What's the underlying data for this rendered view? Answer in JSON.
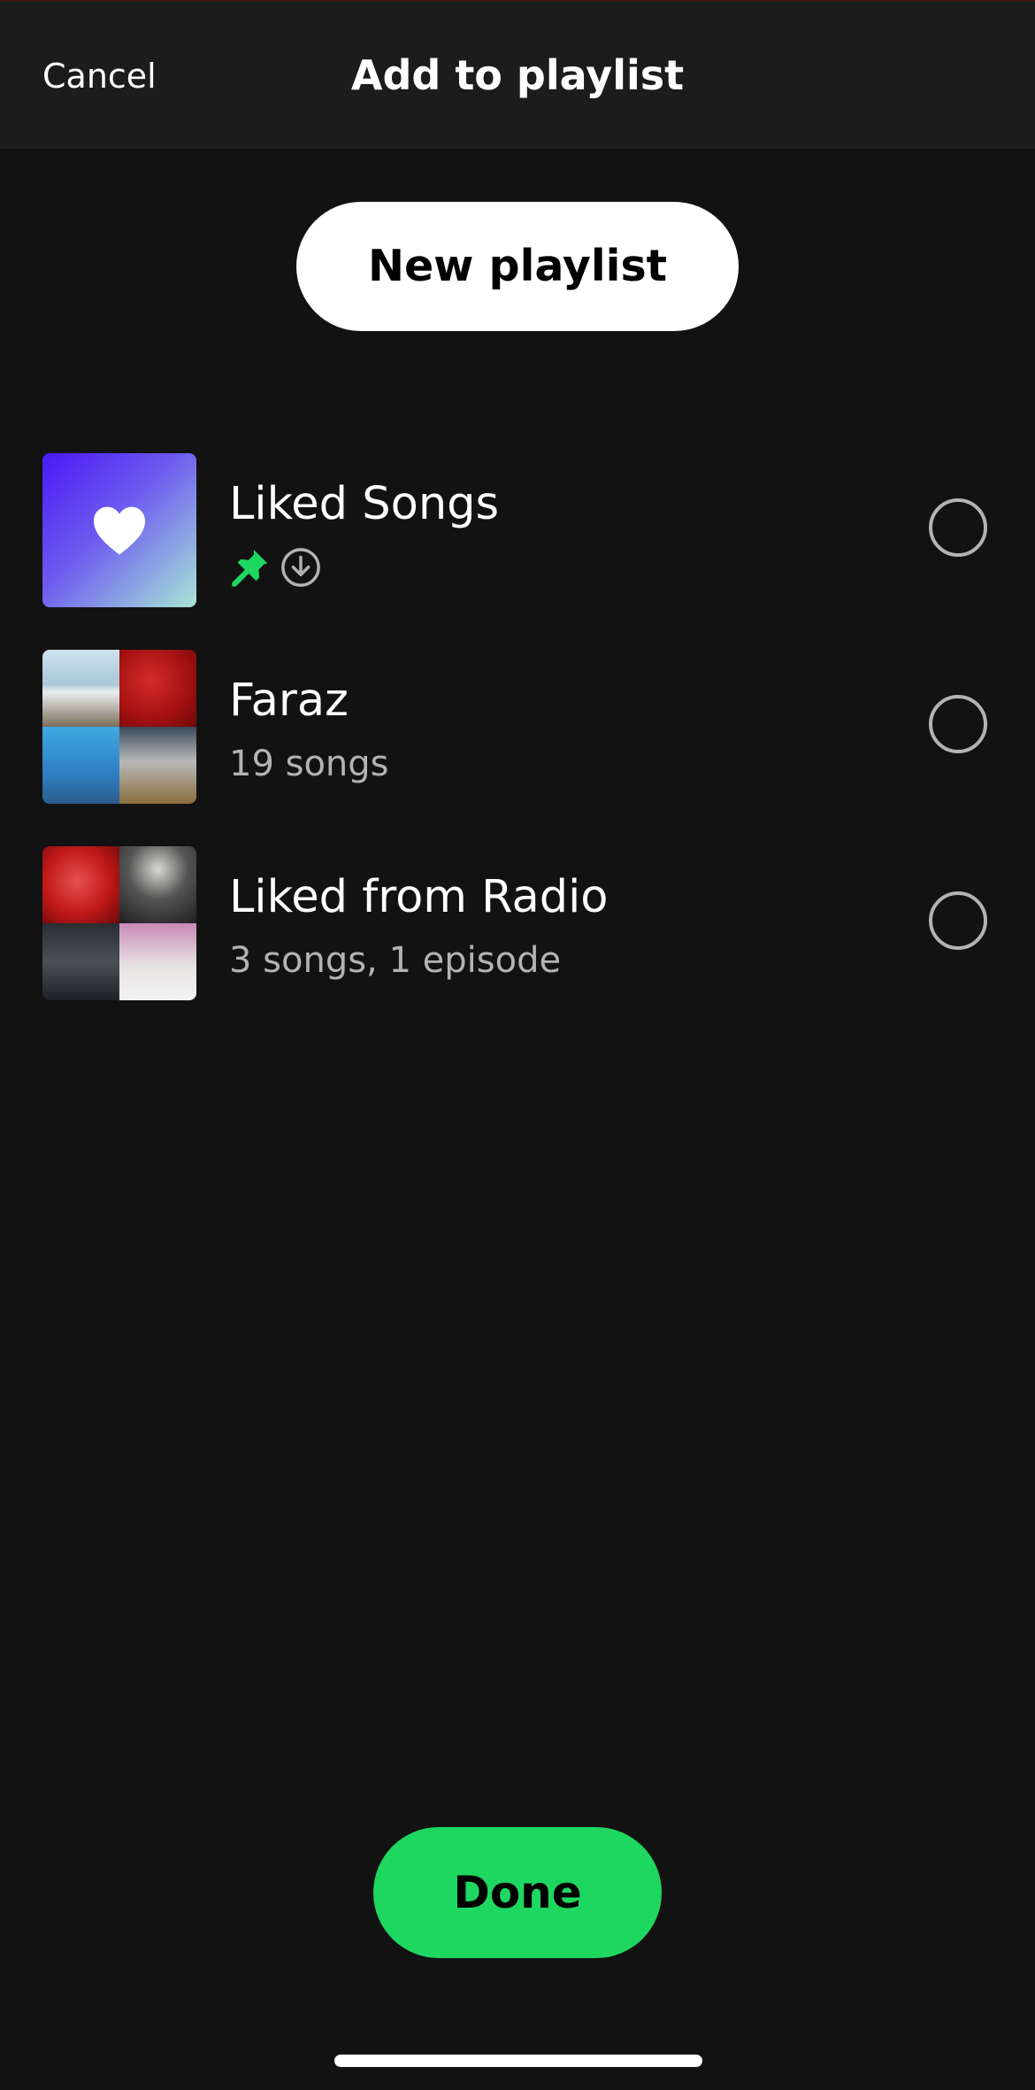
{
  "header": {
    "cancel_label": "Cancel",
    "title": "Add to playlist"
  },
  "actions": {
    "new_playlist_label": "New playlist",
    "done_label": "Done"
  },
  "playlists": [
    {
      "name": "Liked Songs",
      "subtitle": "",
      "badges": [
        "pin-icon",
        "download-icon"
      ],
      "selected": false,
      "cover": "heart-icon"
    },
    {
      "name": "Faraz",
      "subtitle": "19 songs",
      "selected": false,
      "cover": "album-mosaic"
    },
    {
      "name": "Liked from Radio",
      "subtitle": "3 songs, 1 episode",
      "selected": false,
      "cover": "album-mosaic"
    }
  ],
  "colors": {
    "background": "#121212",
    "header_background": "#1c1c1c",
    "accent_green": "#1ed760",
    "secondary_text": "#b3b3b3"
  }
}
